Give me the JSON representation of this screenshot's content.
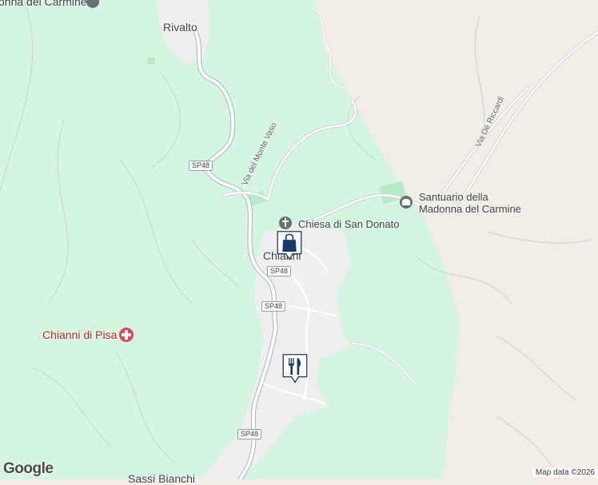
{
  "map": {
    "places": {
      "top_cut": "onna del Carmine",
      "rivalto": "Rivalto",
      "chianni": "Chianni",
      "bottom_cut": "Sassi Bianchi"
    },
    "pois": {
      "chiesa": "Chiesa di San Donato",
      "santuario_line1": "Santuario della",
      "santuario_line2": "Madonna del Carmine",
      "hospital": "Chianni di Pisa"
    },
    "streets": {
      "monte_vaso": "Via del Monte Vaso",
      "riccardi": "Via Dè Riccardi"
    },
    "route_shields": [
      "SP48",
      "SP48",
      "SP48",
      "SP48"
    ],
    "markers": {
      "shopping": "shopping-bag-icon",
      "restaurant": "restaurant-icon"
    },
    "colors": {
      "forest": "#d4f5df",
      "land": "#f3eee5",
      "road": "#ffffff",
      "road_outline": "#c7cbd1",
      "marker_blue": "#1a3a6b",
      "hospital_red": "#e0475a"
    }
  },
  "footer": {
    "logo": "Google",
    "attribution": "Map data ©2026"
  }
}
